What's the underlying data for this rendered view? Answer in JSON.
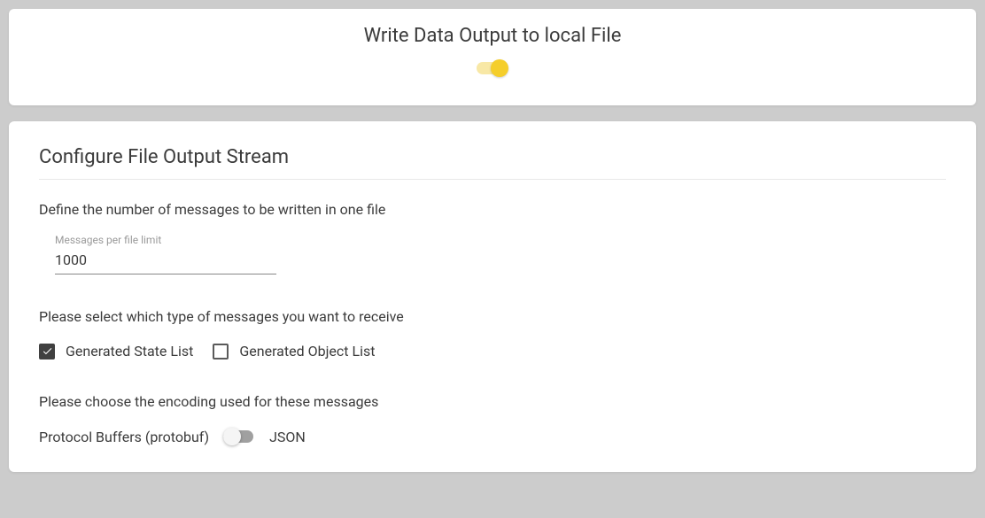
{
  "topPanel": {
    "title": "Write Data Output to local File",
    "toggleOn": true
  },
  "configPanel": {
    "title": "Configure File Output Stream",
    "messagesLimit": {
      "sectionLabel": "Define the number of messages to be written in one file",
      "inputLabel": "Messages per file limit",
      "value": "1000"
    },
    "messageTypes": {
      "sectionLabel": "Please select which type of messages you want to receive",
      "options": [
        {
          "label": "Generated State List",
          "checked": true
        },
        {
          "label": "Generated Object List",
          "checked": false
        }
      ]
    },
    "encoding": {
      "sectionLabel": "Please choose the encoding used for these messages",
      "leftLabel": "Protocol Buffers (protobuf)",
      "rightLabel": "JSON",
      "toggleRight": false
    }
  }
}
